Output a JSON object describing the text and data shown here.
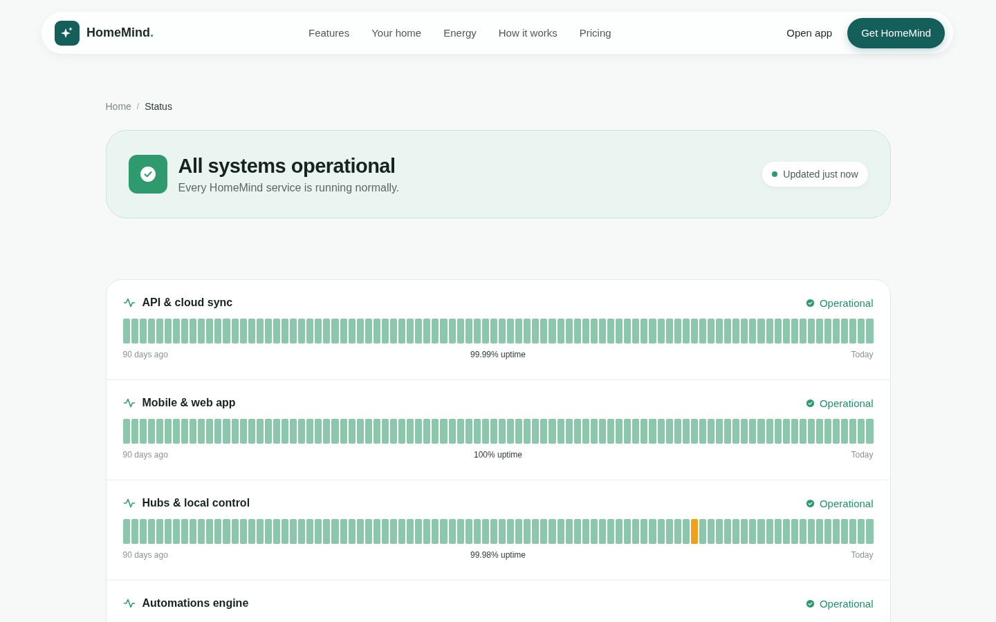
{
  "nav": {
    "brand": "HomeMind",
    "brand_dot": ".",
    "links": [
      "Features",
      "Your home",
      "Energy",
      "How it works",
      "Pricing"
    ],
    "open_app": "Open app",
    "cta": "Get HomeMind"
  },
  "breadcrumb": [
    {
      "label": "Home",
      "selected": false
    },
    {
      "label": "Status",
      "selected": true
    }
  ],
  "breadcrumb_separator": "/",
  "summary": {
    "title": "All systems operational",
    "subtitle": "Every HomeMind service is running normally.",
    "updated": "Updated just now"
  },
  "services": [
    {
      "name": "API & cloud sync",
      "status": "Operational",
      "start": "90 days ago",
      "uptime": "99.99% uptime",
      "end": "Today",
      "days": [
        {
          "incident": false
        },
        {
          "incident": false
        },
        {
          "incident": false
        },
        {
          "incident": false
        },
        {
          "incident": false
        },
        {
          "incident": false
        },
        {
          "incident": false
        },
        {
          "incident": false
        },
        {
          "incident": false
        },
        {
          "incident": false
        },
        {
          "incident": false
        },
        {
          "incident": false
        },
        {
          "incident": false
        },
        {
          "incident": false
        },
        {
          "incident": false
        },
        {
          "incident": false
        },
        {
          "incident": false
        },
        {
          "incident": false
        },
        {
          "incident": false
        },
        {
          "incident": false
        },
        {
          "incident": false
        },
        {
          "incident": false
        },
        {
          "incident": false
        },
        {
          "incident": false
        },
        {
          "incident": false
        },
        {
          "incident": false
        },
        {
          "incident": false
        },
        {
          "incident": false
        },
        {
          "incident": false
        },
        {
          "incident": false
        },
        {
          "incident": false
        },
        {
          "incident": false
        },
        {
          "incident": false
        },
        {
          "incident": false
        },
        {
          "incident": false
        },
        {
          "incident": false
        },
        {
          "incident": false
        },
        {
          "incident": false
        },
        {
          "incident": false
        },
        {
          "incident": false
        },
        {
          "incident": false
        },
        {
          "incident": false
        },
        {
          "incident": false
        },
        {
          "incident": false
        },
        {
          "incident": false
        },
        {
          "incident": false
        },
        {
          "incident": false
        },
        {
          "incident": false
        },
        {
          "incident": false
        },
        {
          "incident": false
        },
        {
          "incident": false
        },
        {
          "incident": false
        },
        {
          "incident": false
        },
        {
          "incident": false
        },
        {
          "incident": false
        },
        {
          "incident": false
        },
        {
          "incident": false
        },
        {
          "incident": false
        },
        {
          "incident": false
        },
        {
          "incident": false
        },
        {
          "incident": false
        },
        {
          "incident": false
        },
        {
          "incident": false
        },
        {
          "incident": false
        },
        {
          "incident": false
        },
        {
          "incident": false
        },
        {
          "incident": false
        },
        {
          "incident": false
        },
        {
          "incident": false
        },
        {
          "incident": false
        },
        {
          "incident": false
        },
        {
          "incident": false
        },
        {
          "incident": false
        },
        {
          "incident": false
        },
        {
          "incident": false
        },
        {
          "incident": false
        },
        {
          "incident": false
        },
        {
          "incident": false
        },
        {
          "incident": false
        },
        {
          "incident": false
        },
        {
          "incident": false
        },
        {
          "incident": false
        },
        {
          "incident": false
        },
        {
          "incident": false
        },
        {
          "incident": false
        },
        {
          "incident": false
        },
        {
          "incident": false
        },
        {
          "incident": false
        },
        {
          "incident": false
        },
        {
          "incident": false
        }
      ]
    },
    {
      "name": "Mobile & web app",
      "status": "Operational",
      "start": "90 days ago",
      "uptime": "100% uptime",
      "end": "Today",
      "days": [
        {
          "incident": false
        },
        {
          "incident": false
        },
        {
          "incident": false
        },
        {
          "incident": false
        },
        {
          "incident": false
        },
        {
          "incident": false
        },
        {
          "incident": false
        },
        {
          "incident": false
        },
        {
          "incident": false
        },
        {
          "incident": false
        },
        {
          "incident": false
        },
        {
          "incident": false
        },
        {
          "incident": false
        },
        {
          "incident": false
        },
        {
          "incident": false
        },
        {
          "incident": false
        },
        {
          "incident": false
        },
        {
          "incident": false
        },
        {
          "incident": false
        },
        {
          "incident": false
        },
        {
          "incident": false
        },
        {
          "incident": false
        },
        {
          "incident": false
        },
        {
          "incident": false
        },
        {
          "incident": false
        },
        {
          "incident": false
        },
        {
          "incident": false
        },
        {
          "incident": false
        },
        {
          "incident": false
        },
        {
          "incident": false
        },
        {
          "incident": false
        },
        {
          "incident": false
        },
        {
          "incident": false
        },
        {
          "incident": false
        },
        {
          "incident": false
        },
        {
          "incident": false
        },
        {
          "incident": false
        },
        {
          "incident": false
        },
        {
          "incident": false
        },
        {
          "incident": false
        },
        {
          "incident": false
        },
        {
          "incident": false
        },
        {
          "incident": false
        },
        {
          "incident": false
        },
        {
          "incident": false
        },
        {
          "incident": false
        },
        {
          "incident": false
        },
        {
          "incident": false
        },
        {
          "incident": false
        },
        {
          "incident": false
        },
        {
          "incident": false
        },
        {
          "incident": false
        },
        {
          "incident": false
        },
        {
          "incident": false
        },
        {
          "incident": false
        },
        {
          "incident": false
        },
        {
          "incident": false
        },
        {
          "incident": false
        },
        {
          "incident": false
        },
        {
          "incident": false
        },
        {
          "incident": false
        },
        {
          "incident": false
        },
        {
          "incident": false
        },
        {
          "incident": false
        },
        {
          "incident": false
        },
        {
          "incident": false
        },
        {
          "incident": false
        },
        {
          "incident": false
        },
        {
          "incident": false
        },
        {
          "incident": false
        },
        {
          "incident": false
        },
        {
          "incident": false
        },
        {
          "incident": false
        },
        {
          "incident": false
        },
        {
          "incident": false
        },
        {
          "incident": false
        },
        {
          "incident": false
        },
        {
          "incident": false
        },
        {
          "incident": false
        },
        {
          "incident": false
        },
        {
          "incident": false
        },
        {
          "incident": false
        },
        {
          "incident": false
        },
        {
          "incident": false
        },
        {
          "incident": false
        },
        {
          "incident": false
        },
        {
          "incident": false
        },
        {
          "incident": false
        },
        {
          "incident": false
        },
        {
          "incident": false
        }
      ]
    },
    {
      "name": "Hubs & local control",
      "status": "Operational",
      "start": "90 days ago",
      "uptime": "99.98% uptime",
      "end": "Today",
      "days": [
        {
          "incident": false
        },
        {
          "incident": false
        },
        {
          "incident": false
        },
        {
          "incident": false
        },
        {
          "incident": false
        },
        {
          "incident": false
        },
        {
          "incident": false
        },
        {
          "incident": false
        },
        {
          "incident": false
        },
        {
          "incident": false
        },
        {
          "incident": false
        },
        {
          "incident": false
        },
        {
          "incident": false
        },
        {
          "incident": false
        },
        {
          "incident": false
        },
        {
          "incident": false
        },
        {
          "incident": false
        },
        {
          "incident": false
        },
        {
          "incident": false
        },
        {
          "incident": false
        },
        {
          "incident": false
        },
        {
          "incident": false
        },
        {
          "incident": false
        },
        {
          "incident": false
        },
        {
          "incident": false
        },
        {
          "incident": false
        },
        {
          "incident": false
        },
        {
          "incident": false
        },
        {
          "incident": false
        },
        {
          "incident": false
        },
        {
          "incident": false
        },
        {
          "incident": false
        },
        {
          "incident": false
        },
        {
          "incident": false
        },
        {
          "incident": false
        },
        {
          "incident": false
        },
        {
          "incident": false
        },
        {
          "incident": false
        },
        {
          "incident": false
        },
        {
          "incident": false
        },
        {
          "incident": false
        },
        {
          "incident": false
        },
        {
          "incident": false
        },
        {
          "incident": false
        },
        {
          "incident": false
        },
        {
          "incident": false
        },
        {
          "incident": false
        },
        {
          "incident": false
        },
        {
          "incident": false
        },
        {
          "incident": false
        },
        {
          "incident": false
        },
        {
          "incident": false
        },
        {
          "incident": false
        },
        {
          "incident": false
        },
        {
          "incident": false
        },
        {
          "incident": false
        },
        {
          "incident": false
        },
        {
          "incident": false
        },
        {
          "incident": false
        },
        {
          "incident": false
        },
        {
          "incident": false
        },
        {
          "incident": false
        },
        {
          "incident": false
        },
        {
          "incident": false
        },
        {
          "incident": false
        },
        {
          "incident": false
        },
        {
          "incident": false
        },
        {
          "incident": false
        },
        {
          "incident": true
        },
        {
          "incident": false
        },
        {
          "incident": false
        },
        {
          "incident": false
        },
        {
          "incident": false
        },
        {
          "incident": false
        },
        {
          "incident": false
        },
        {
          "incident": false
        },
        {
          "incident": false
        },
        {
          "incident": false
        },
        {
          "incident": false
        },
        {
          "incident": false
        },
        {
          "incident": false
        },
        {
          "incident": false
        },
        {
          "incident": false
        },
        {
          "incident": false
        },
        {
          "incident": false
        },
        {
          "incident": false
        },
        {
          "incident": false
        },
        {
          "incident": false
        },
        {
          "incident": false
        },
        {
          "incident": false
        }
      ]
    },
    {
      "name": "Automations engine",
      "status": "Operational"
    }
  ]
}
